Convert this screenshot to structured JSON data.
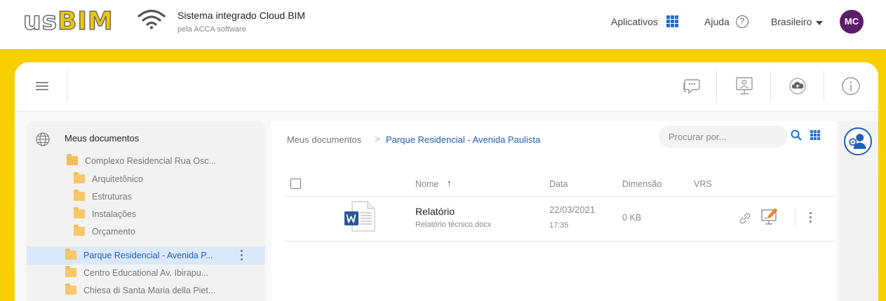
{
  "header": {
    "logo_text_us": "us",
    "logo_text_bim": "BIM",
    "title": "Sistema integrado Cloud BIM",
    "subtitle": "pela ACCA software",
    "apps_label": "Aplicativos",
    "help_label": "Ajuda",
    "help_glyph": "?",
    "language": "Brasileiro",
    "avatar_initials": "MC",
    "avatar_color": "#5b1f6a"
  },
  "toolbar": {
    "icons": [
      "menu-icon",
      "chat-icon",
      "presentation-icon",
      "cloud-upload-icon",
      "info-icon"
    ]
  },
  "sidebar": {
    "root_label": "Meus documentos",
    "items": [
      {
        "label": "Complexo Residencial Rua Osc...",
        "level": 1
      },
      {
        "label": "Arquitetônico",
        "level": 2
      },
      {
        "label": "Estruturas",
        "level": 2
      },
      {
        "label": "Instalações",
        "level": 2
      },
      {
        "label": "Orçamento",
        "level": 2
      },
      {
        "label": "Parque Residencial - Avenida P...",
        "level": 0,
        "selected": true
      },
      {
        "label": "Centro Educational Av. Ibirapu...",
        "level": 0
      },
      {
        "label": "Chiesa di Santa Maria della Piet...",
        "level": 0
      }
    ]
  },
  "content": {
    "breadcrumb": [
      "Meus documentos",
      "Parque Residencial - Avenida Paulista"
    ],
    "breadcrumb_sep": ">",
    "search_placeholder": "Procurar por...",
    "columns": {
      "name": "Nome",
      "date": "Data",
      "size": "Dimensão",
      "vrs": "VRS"
    },
    "sort_arrow": "↑",
    "files": [
      {
        "name": "Relatório",
        "description": "Relatório técnico.docx",
        "date": "22/03/2021",
        "time": "17:35",
        "size": "0 KB",
        "icon": "word-document-icon"
      }
    ]
  },
  "colors": {
    "accent": "#1e6fd9",
    "selected_bg": "#dbe8f9",
    "band_yellow": "#f7cf00",
    "folder": "#f4bd5a"
  }
}
